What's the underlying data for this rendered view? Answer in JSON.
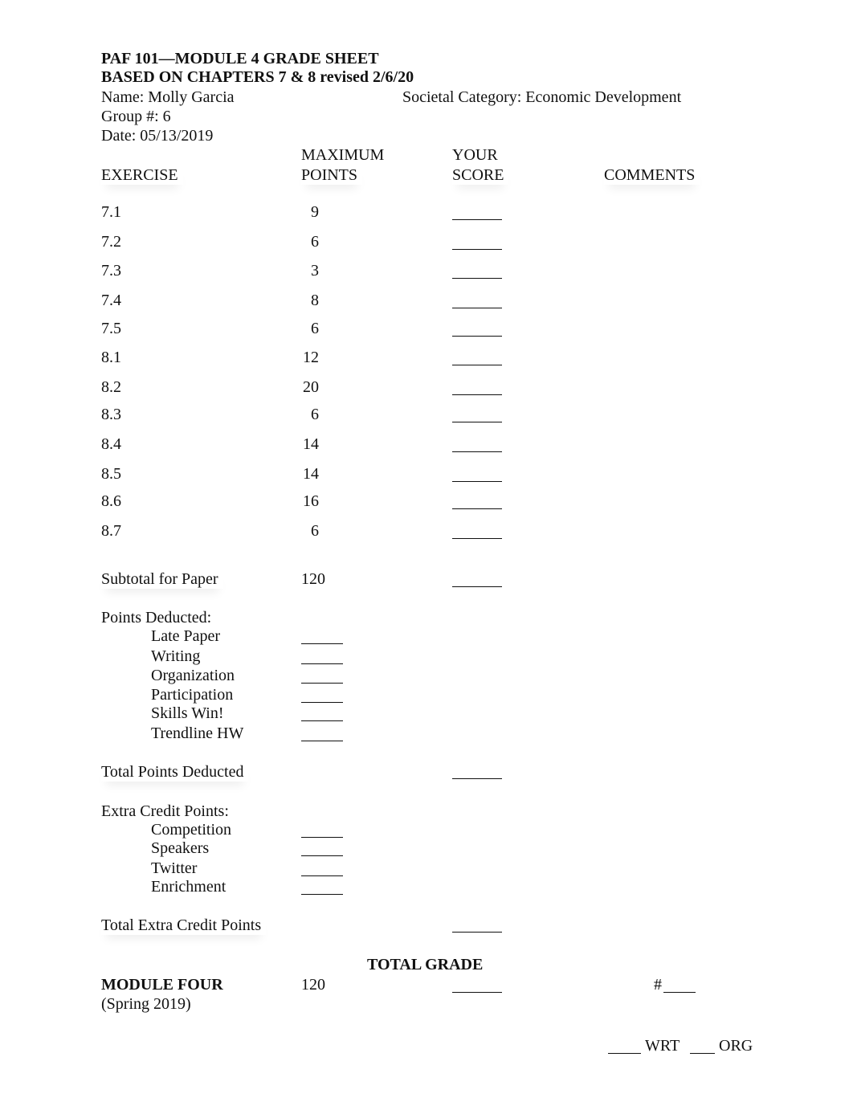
{
  "header": {
    "title_line1": "PAF 101—MODULE 4 GRADE SHEET",
    "title_line2": "BASED ON CHAPTERS 7 & 8 revised 2/6/20",
    "name": "Name: Molly Garcia",
    "societal_category": "Societal Category: Economic Development",
    "group": "Group #: 6",
    "date": "Date: 05/13/2019"
  },
  "columns": {
    "exercise": "EXERCISE",
    "max_line1": "MAXIMUM",
    "max_line2": "POINTS",
    "score_line1": "YOUR",
    "score_line2": "SCORE",
    "comments": "COMMENTS"
  },
  "exercises": [
    {
      "id": "7.1",
      "max": "9"
    },
    {
      "id": "7.2",
      "max": "6"
    },
    {
      "id": "7.3",
      "max": "3"
    },
    {
      "id": "7.4",
      "max": "8"
    },
    {
      "id": "7.5",
      "max": "6"
    },
    {
      "id": "8.1",
      "max": "12"
    },
    {
      "id": "8.2",
      "max": "20"
    },
    {
      "id": "8.3",
      "max": "6"
    },
    {
      "id": "8.4",
      "max": "14"
    },
    {
      "id": "8.5",
      "max": "14"
    },
    {
      "id": "8.6",
      "max": "16"
    },
    {
      "id": "8.7",
      "max": "6"
    }
  ],
  "subtotal": {
    "label": "Subtotal for Paper",
    "max": "120"
  },
  "deductions": {
    "heading": "Points Deducted:",
    "items": [
      "Late Paper",
      "Writing",
      "Organization",
      "Participation",
      "Skills Win!",
      "Trendline HW"
    ],
    "total_label": "Total Points Deducted"
  },
  "extra_credit": {
    "heading": "Extra Credit Points:",
    "items": [
      "Competition",
      "Speakers",
      "Twitter",
      "Enrichment"
    ],
    "total_label": "Total Extra Credit Points"
  },
  "total": {
    "heading": "TOTAL GRADE",
    "module_label": "MODULE FOUR",
    "max": "120",
    "number_prefix": "#",
    "term": "(Spring 2019)"
  },
  "footer": {
    "wrt_label": "WRT",
    "org_label": "ORG"
  }
}
